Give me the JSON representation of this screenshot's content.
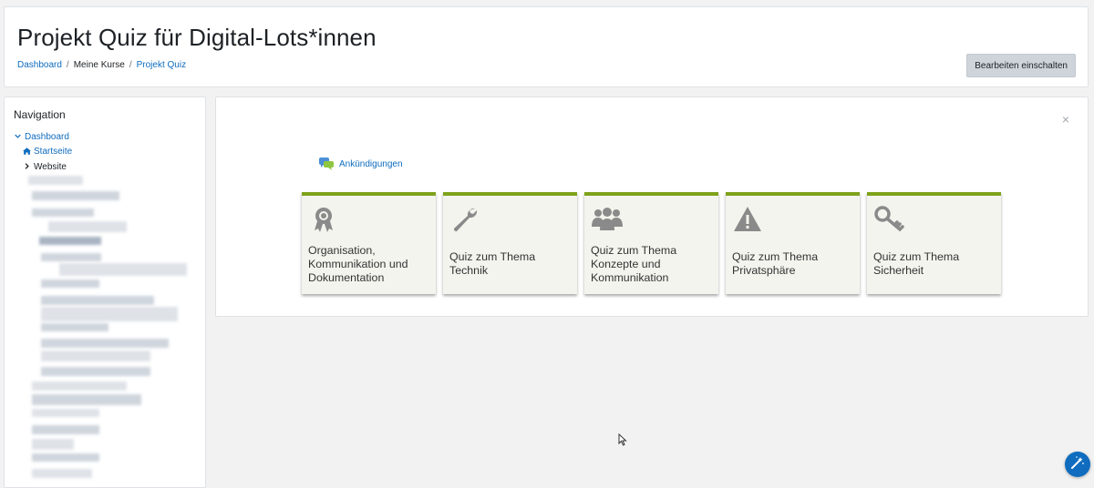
{
  "header": {
    "title": "Projekt Quiz für Digital-Lots*innen",
    "breadcrumb": [
      {
        "label": "Dashboard",
        "link": true
      },
      {
        "label": "Meine Kurse",
        "link": false
      },
      {
        "label": "Projekt Quiz",
        "link": true
      }
    ],
    "breadcrumb_separator": "/",
    "edit_button": "Bearbeiten einschalten"
  },
  "navigation": {
    "title": "Navigation",
    "items": [
      {
        "label": "Dashboard",
        "icon": "chevron-down-icon"
      },
      {
        "label": "Startseite",
        "icon": "home-icon"
      },
      {
        "label": "Website",
        "icon": "chevron-right-icon"
      }
    ]
  },
  "main": {
    "close_symbol": "×",
    "announcements": "Ankündigungen",
    "tiles": [
      {
        "label": "Organisation, Kommunikation und Dokumentation",
        "icon": "award-icon"
      },
      {
        "label": "Quiz zum Thema Technik",
        "icon": "wrench-icon"
      },
      {
        "label": "Quiz zum Thema Konzepte und Kommunikation",
        "icon": "users-icon"
      },
      {
        "label": "Quiz zum Thema Privatsphäre",
        "icon": "warning-icon"
      },
      {
        "label": "Quiz zum Thema Sicherheit",
        "icon": "key-icon"
      }
    ]
  },
  "colors": {
    "link": "#0f6cbf",
    "tile_accent": "#7ea21b",
    "tile_bg": "#f4f4ee",
    "icon_gray": "#8a8a8a"
  }
}
